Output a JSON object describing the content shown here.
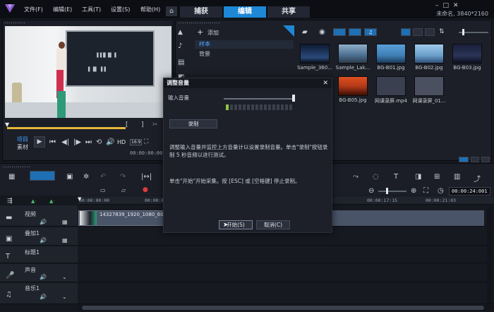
{
  "menu": [
    "文件(F)",
    "编辑(E)",
    "工具(T)",
    "设置(S)",
    "帮助(H)"
  ],
  "workspace_tabs": [
    {
      "label": "捕获",
      "active": false
    },
    {
      "label": "编辑",
      "active": true
    },
    {
      "label": "共享",
      "active": false
    }
  ],
  "project_info": "未命名, 3840*2160",
  "preview": {
    "mode_project": "项目",
    "mode_clip": "素材",
    "hd_label": "HD",
    "ratio_label": "16:9",
    "timecode": "00:00:00:00"
  },
  "library": {
    "add_label": "添加",
    "folders": [
      "样本",
      "背景"
    ],
    "thumbnails": [
      {
        "label": "Sample_360...",
        "color": "#2a4a7a"
      },
      {
        "label": "Sample_Lak...",
        "color": "#4a6e8f"
      },
      {
        "label": "BG-B01.jpg",
        "color": "#3f7fb5"
      },
      {
        "label": "BG-B02.jpg",
        "color": "#6a9fca"
      },
      {
        "label": "BG-B03.jpg",
        "color": "#2b3558"
      },
      {
        "label": "BG-B05.jpg",
        "color": "#b33a18"
      },
      {
        "label": "网课录屏.mp4",
        "color": "#3a4050"
      },
      {
        "label": "网课录屏_01...",
        "color": "#4a5060"
      }
    ]
  },
  "timeline": {
    "timecode": "00:00:24:001",
    "ruler": [
      "00:00:00:00",
      "00:00:03:",
      "00:00:17:15",
      "00:00:21:03"
    ],
    "clip_label": "14327839_1920_1080_60fp",
    "tracks": [
      "视频",
      "叠加1",
      "标题1",
      "声音",
      "音乐1"
    ]
  },
  "dialog": {
    "title": "调整音量",
    "input_volume_label": "输入音量",
    "record_button": "录制",
    "text1": "调整输入音量并监控上方音量计以设置录制音量。单击\"录制\"按钮录制 5 秒音频以进行测试。",
    "text2": "单击\"开始\"开始采集。按 [ESC] 或 [空格键] 停止录制。",
    "start_button": "开始(S)",
    "cancel_button": "取消(C)"
  }
}
